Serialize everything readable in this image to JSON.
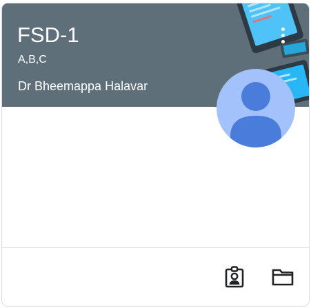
{
  "class_card": {
    "title": "FSD-1",
    "section": "A,B,C",
    "teacher": "Dr Bheemappa Halavar"
  },
  "icons": {
    "more": "more-vert-icon",
    "avatar": "person-avatar-icon",
    "work": "assignment-ind-icon",
    "folder": "folder-icon"
  },
  "colors": {
    "header_bg": "#5f6f79",
    "avatar_bg": "#a3c1fa",
    "avatar_fg": "#4a7ddb",
    "icon": "#202124"
  }
}
